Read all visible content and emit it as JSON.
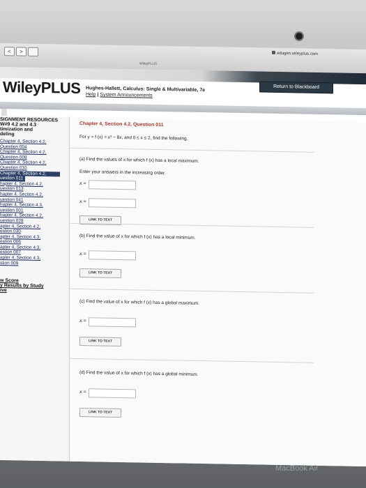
{
  "browser": {
    "url": "edugen.wileyplus.com",
    "tab_title": "WileyPLUS",
    "back_label": "<",
    "forward_label": ">"
  },
  "header": {
    "logo": "WileyPLUS",
    "course_title": "Hughes-Hallett, Calculus: Single & Multivariable, 7e",
    "help_link": "Help",
    "separator": "|",
    "announcements_link": "System Announcements",
    "return_button": "Return to Blackboard"
  },
  "sidebar": {
    "heading": "SIGNMENT RESOURCES",
    "assignment_title": [
      "W#9 4.2 and 4.3",
      "timization and",
      "deling"
    ],
    "items": [
      [
        "Chapter 4, Section 4.2,",
        "Question 004"
      ],
      [
        "Chapter 4, Section 4.2,",
        "Question 008"
      ],
      [
        "Chapter 4, Section 4.2,",
        "Question 010"
      ],
      [
        "Chapter 4, Section 4.2,",
        "uestion 011"
      ],
      [
        "hapter 4, Section 4.2,",
        "uestion 013"
      ],
      [
        "hapter 4, Section 4.2,",
        "uestion 041"
      ],
      [
        "hapter 4, Section 4.3,",
        "uestion 001"
      ],
      [
        "hapter 4, Section 4.2,",
        "uestion 028"
      ],
      [
        "apter 4, Section 4.2,",
        "estion 030"
      ],
      [
        "apter 4, Section 4.3,",
        "estion 006"
      ],
      [
        "apter 4, Section 4.3,",
        "estion 007"
      ],
      [
        "apter 4, Section 4.3,",
        "stion 009"
      ]
    ],
    "score_link": "w Score",
    "results_link": [
      "y Results by Study",
      "ive"
    ]
  },
  "question": {
    "title": "Chapter 4, Section 4.2, Question 011",
    "statement": "For y = f (x) = x³ − 8x, and 0 ≤ x ≤ 2, find the following.",
    "note": "Enter your answers in the increasing order.",
    "x_label": "x =",
    "link_to_text": "LINK TO TEXT",
    "part_a": "(a) Find the values of x for which f (x) has a local maximum.",
    "part_b": "(b) Find the value of x for which f (x) has a local minimum.",
    "part_c": "(c) Find the value of x for which f (x) has a global maximum.",
    "part_d": "(d) Find the value of x for which f (x) has a global minimum."
  },
  "device": {
    "label": "MacBook Air"
  }
}
